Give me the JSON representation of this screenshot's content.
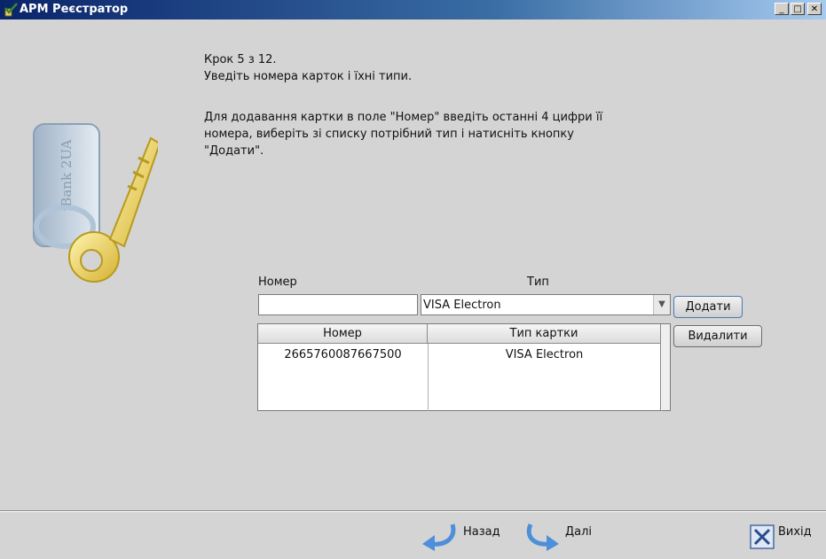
{
  "window": {
    "title": "АРМ Реєстратор",
    "icon": "key-check-icon",
    "controls": [
      "minimize-icon",
      "maximize-icon",
      "close-icon"
    ]
  },
  "logo": {
    "text": "iBank 2UA",
    "icon": "ibank-key-icon"
  },
  "instructions": {
    "step": "Крок 5 з 12.",
    "prompt": "Уведіть номера карток і їхні типи.",
    "line1": "Для додавання картки в поле \"Номер\" введіть останні 4 цифри її",
    "line2": "номера, виберіть зі списку потрібний тип і натисніть кнопку",
    "line3": "\"Додати\"."
  },
  "form": {
    "number_label": "Номер",
    "type_label": "Тип",
    "number_value": "",
    "type_selected": "VISA Electron",
    "add_button": "Додати",
    "delete_button": "Видалити"
  },
  "table": {
    "columns": [
      "Номер",
      "Тип картки"
    ],
    "rows": [
      {
        "number": "2665760087667500",
        "type": "VISA Electron"
      }
    ]
  },
  "footer": {
    "back": "Назад",
    "next": "Далі",
    "exit": "Вихід"
  },
  "colors": {
    "background": "#d4d4d4",
    "title_start": "#0a246a",
    "title_end": "#a6caf0"
  }
}
